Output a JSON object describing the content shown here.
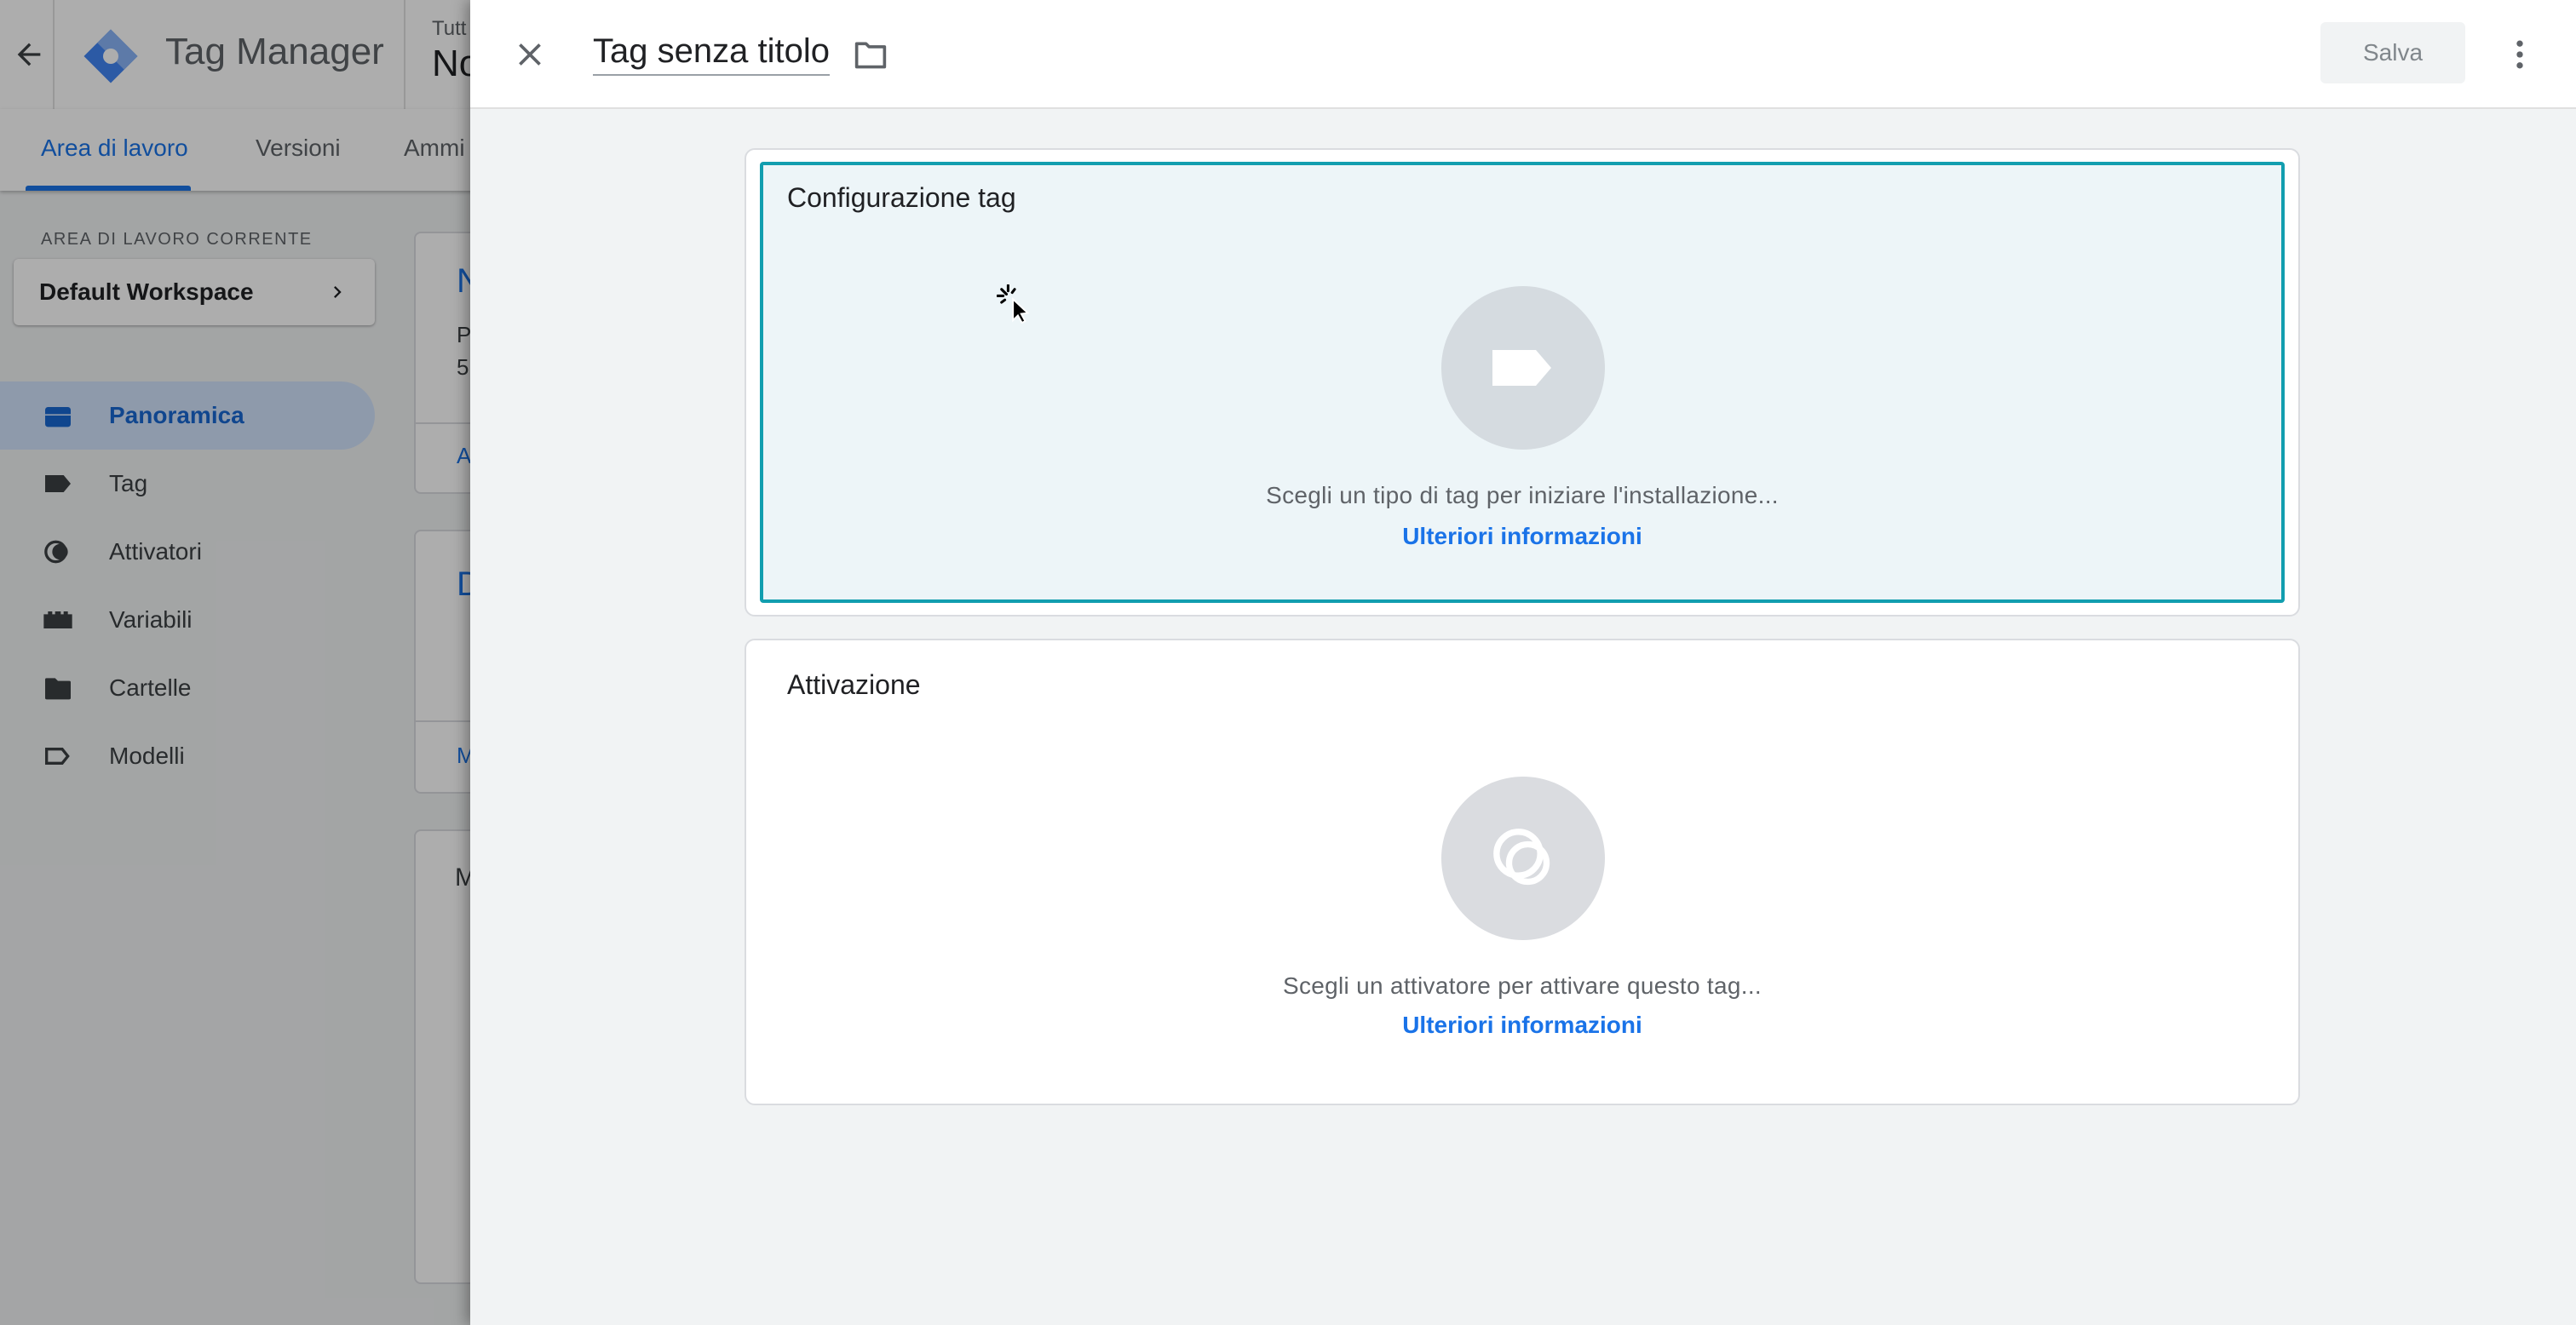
{
  "background_app": {
    "app_title": "Tag Manager",
    "account_small": "Tutt",
    "account_big": "No",
    "nav_tabs": [
      {
        "label": "Area di lavoro",
        "active": true
      },
      {
        "label": "Versioni",
        "active": false
      },
      {
        "label": "Ammi",
        "active": false
      }
    ],
    "workspace_label": "AREA DI LAVORO CORRENTE",
    "workspace_name": "Default Workspace",
    "sidebar": {
      "items": [
        {
          "label": "Panoramica",
          "icon": "briefcase-icon",
          "active": true
        },
        {
          "label": "Tag",
          "icon": "tag-icon",
          "active": false
        },
        {
          "label": "Attivatori",
          "icon": "trigger-icon",
          "active": false
        },
        {
          "label": "Variabili",
          "icon": "variables-icon",
          "active": false
        },
        {
          "label": "Cartelle",
          "icon": "folder-icon",
          "active": false
        },
        {
          "label": "Modelli",
          "icon": "template-icon",
          "active": false
        }
      ]
    },
    "card_peeks": {
      "c1_line1": "N",
      "c1_line2": "P",
      "c1_line3": "5",
      "c1_link": "A",
      "c2_line1": "D",
      "c2_link": "M",
      "c3_line1": "M"
    }
  },
  "editor": {
    "tag_name": "Tag senza titolo",
    "save_label": "Salva",
    "tag_config": {
      "title": "Configurazione tag",
      "hint": "Scegli un tipo di tag per iniziare l'installazione...",
      "link": "Ulteriori informazioni"
    },
    "triggering": {
      "title": "Attivazione",
      "hint": "Scegli un attivatore per attivare questo tag...",
      "link": "Ulteriori informazioni"
    }
  },
  "colors": {
    "accent": "#1a73e8",
    "selected_border": "#129eaf",
    "selected_bg": "#edf5f8"
  }
}
